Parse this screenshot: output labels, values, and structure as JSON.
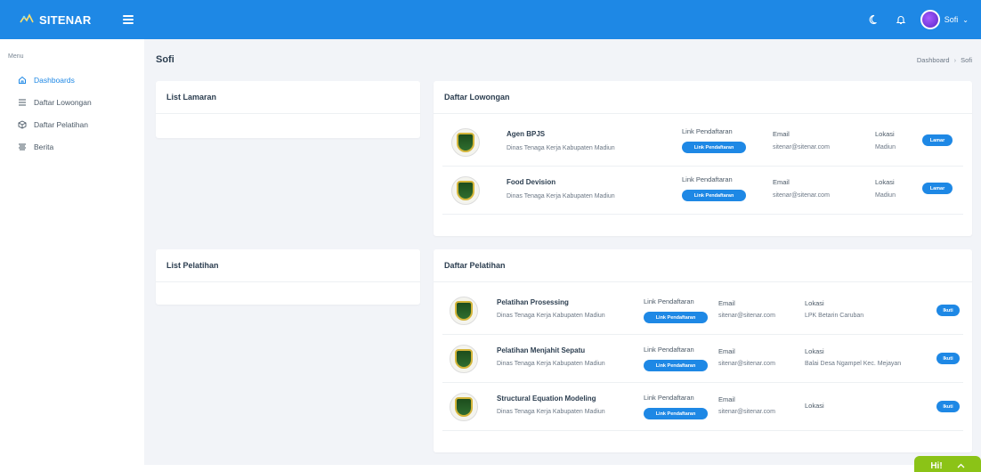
{
  "topbar": {
    "brand": "SITENAR",
    "user": "Sofi"
  },
  "sidebar": {
    "heading": "Menu",
    "items": [
      {
        "label": "Dashboards",
        "icon": "home-icon"
      },
      {
        "label": "Daftar Lowongan",
        "icon": "list-icon"
      },
      {
        "label": "Daftar Pelatihan",
        "icon": "box-icon"
      },
      {
        "label": "Berita",
        "icon": "news-icon"
      }
    ]
  },
  "page": {
    "title": "Sofi",
    "breadcrumb": [
      "Dashboard",
      "Sofi"
    ]
  },
  "list_lamaran": {
    "title": "List Lamaran"
  },
  "list_pelatihan": {
    "title": "List Pelatihan"
  },
  "lowongan": {
    "title": "Daftar Lowongan",
    "rows": [
      {
        "name": "Agen BPJS",
        "org": "Dinas Tenaga Kerja Kabupaten Madiun",
        "link_label": "Link Pendaftaran",
        "link_button": "Link Pendaftaran",
        "email_label": "Email",
        "email": "sitenar@sitenar.com",
        "lokasi_label": "Lokasi",
        "lokasi": "Madiun",
        "action": "Lamar"
      },
      {
        "name": "Food Devision",
        "org": "Dinas Tenaga Kerja Kabupaten Madiun",
        "link_label": "Link Pendaftaran",
        "link_button": "Link Pendaftaran",
        "email_label": "Email",
        "email": "sitenar@sitenar.com",
        "lokasi_label": "Lokasi",
        "lokasi": "Madiun",
        "action": "Lamar"
      }
    ]
  },
  "pelatihan": {
    "title": "Daftar Pelatihan",
    "rows": [
      {
        "name": "Pelatihan Prosessing",
        "org": "Dinas Tenaga Kerja Kabupaten Madiun",
        "link_label": "Link Pendaftaran",
        "link_button": "Link Pendaftaran",
        "email_label": "Email",
        "email": "sitenar@sitenar.com",
        "lokasi_label": "Lokasi",
        "lokasi": "LPK Betarin Caruban",
        "action": "Ikuti"
      },
      {
        "name": "Pelatihan Menjahit Sepatu",
        "org": "Dinas Tenaga Kerja Kabupaten Madiun",
        "link_label": "Link Pendaftaran",
        "link_button": "Link Pendaftaran",
        "email_label": "Email",
        "email": "sitenar@sitenar.com",
        "lokasi_label": "Lokasi",
        "lokasi": "Balai Desa Ngampel Kec. Mejayan",
        "action": "Ikuti"
      },
      {
        "name": "Structural Equation Modeling",
        "org": "Dinas Tenaga Kerja Kabupaten Madiun",
        "link_label": "Link Pendaftaran",
        "link_button": "Link Pendaftaran",
        "email_label": "Email",
        "email": "sitenar@sitenar.com",
        "lokasi_label": "Lokasi",
        "lokasi": "",
        "action": "Ikuti"
      }
    ]
  },
  "chat": {
    "label": "Hi!"
  },
  "colors": {
    "primary": "#1e88e5",
    "chat": "#8bc317",
    "background": "#f2f4f8"
  }
}
